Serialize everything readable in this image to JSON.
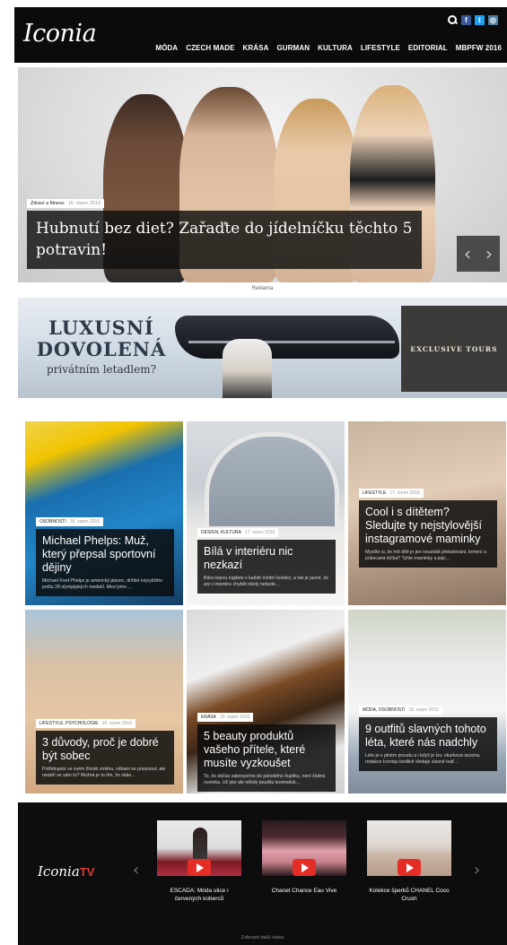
{
  "header": {
    "logo": "Iconia",
    "nav": [
      "MÓDA",
      "CZECH MADE",
      "KRÁSA",
      "GURMAN",
      "KULTURA",
      "LIFESTYLE",
      "EDITORIAL",
      "MBPFW 2016"
    ],
    "social": [
      "facebook-icon",
      "twitter-icon",
      "instagram-icon"
    ]
  },
  "hero": {
    "category": "Zdraví a fitness",
    "date": "16. srpen 2016",
    "title": "Hubnutí bez diet? Zařaďte do jídelníčku těchto 5 potravin!",
    "prev": "‹",
    "next": "›"
  },
  "ad": {
    "label": "Reklama",
    "line1": "LUXUSNÍ",
    "line2": "DOVOLENÁ",
    "line3": "privátním letadlem?",
    "box": "EXCLUSIVE TOURS"
  },
  "articles": [
    {
      "category": "OSOBNOSTI",
      "date": "18. srpen 2016",
      "title": "Michael Phelps: Muž, který přepsal sportovní dějiny",
      "excerpt": "Michael Fred Phelps je americký plavec, držitel nejvyššího počtu 28 olympijských medailí. Mezi jeho ..."
    },
    {
      "category": "DESIGN, KULTURA",
      "date": "17. srpen 2016",
      "title": "Bílá v interiéru nic nezkazí",
      "excerpt": "Bílou barvu najdete v každé módní kolekci, a tak je jasné, že ani v interiéru chybět nikdy nebude..."
    },
    {
      "category": "LIFESTYLE",
      "date": "17. srpen 2016",
      "title": "Cool i s dítětem? Sledujte ty nejstylovější instagramové maminky",
      "excerpt": "Myslíte si, že mít dítě je jen neustálé přebalování, lemení a pokecaná trička? Tyhle maminky a jejic..."
    },
    {
      "category": "LIFESTYLE, PSYCHOLOGIE",
      "date": "16. srpen 2016",
      "title": "3 důvody, proč je dobré být sobec",
      "excerpt": "Potřebujete ve svém životě změnu, někam se posunout, ale nedaří se vám to? Možná je to tím, že stále..."
    },
    {
      "category": "KRÁSA",
      "date": "16. srpen 2016",
      "title": "5 beauty produktů vašeho přítele, které musíte vyzkoušet",
      "excerpt": "To, že občas zabrousíme do pánského šuplíku, není žádná novinka. Už jste ale někdy použila kosmetick..."
    },
    {
      "category": "MÓDA, OSOBNOSTI",
      "date": "16. srpen 2016",
      "title": "9 outfitů slavných tohoto léta, které nás nadchly",
      "excerpt": "Léto je v plném proudu a i když je tzv. okurková sezona, redakce Iconiqu bedlivě sleduje slavné tvář..."
    }
  ],
  "tv": {
    "logo": "Iconia",
    "logo_tv": "TV",
    "prev": "‹",
    "next": "›",
    "videos": [
      {
        "title": "ESCADA: Móda ulice i červených koberců"
      },
      {
        "title": "Chanel Chance Eau Vive"
      },
      {
        "title": "Kolekce šperků CHANEL Coco Crush"
      }
    ],
    "more": "Zobrazit další videa"
  },
  "colors": {
    "header_bg": "#0b0b0b",
    "accent_tv": "#e03b2f",
    "play_button": "#e52d27",
    "facebook": "#3b5998",
    "twitter": "#1da1f2",
    "instagram": "#517fa4"
  }
}
